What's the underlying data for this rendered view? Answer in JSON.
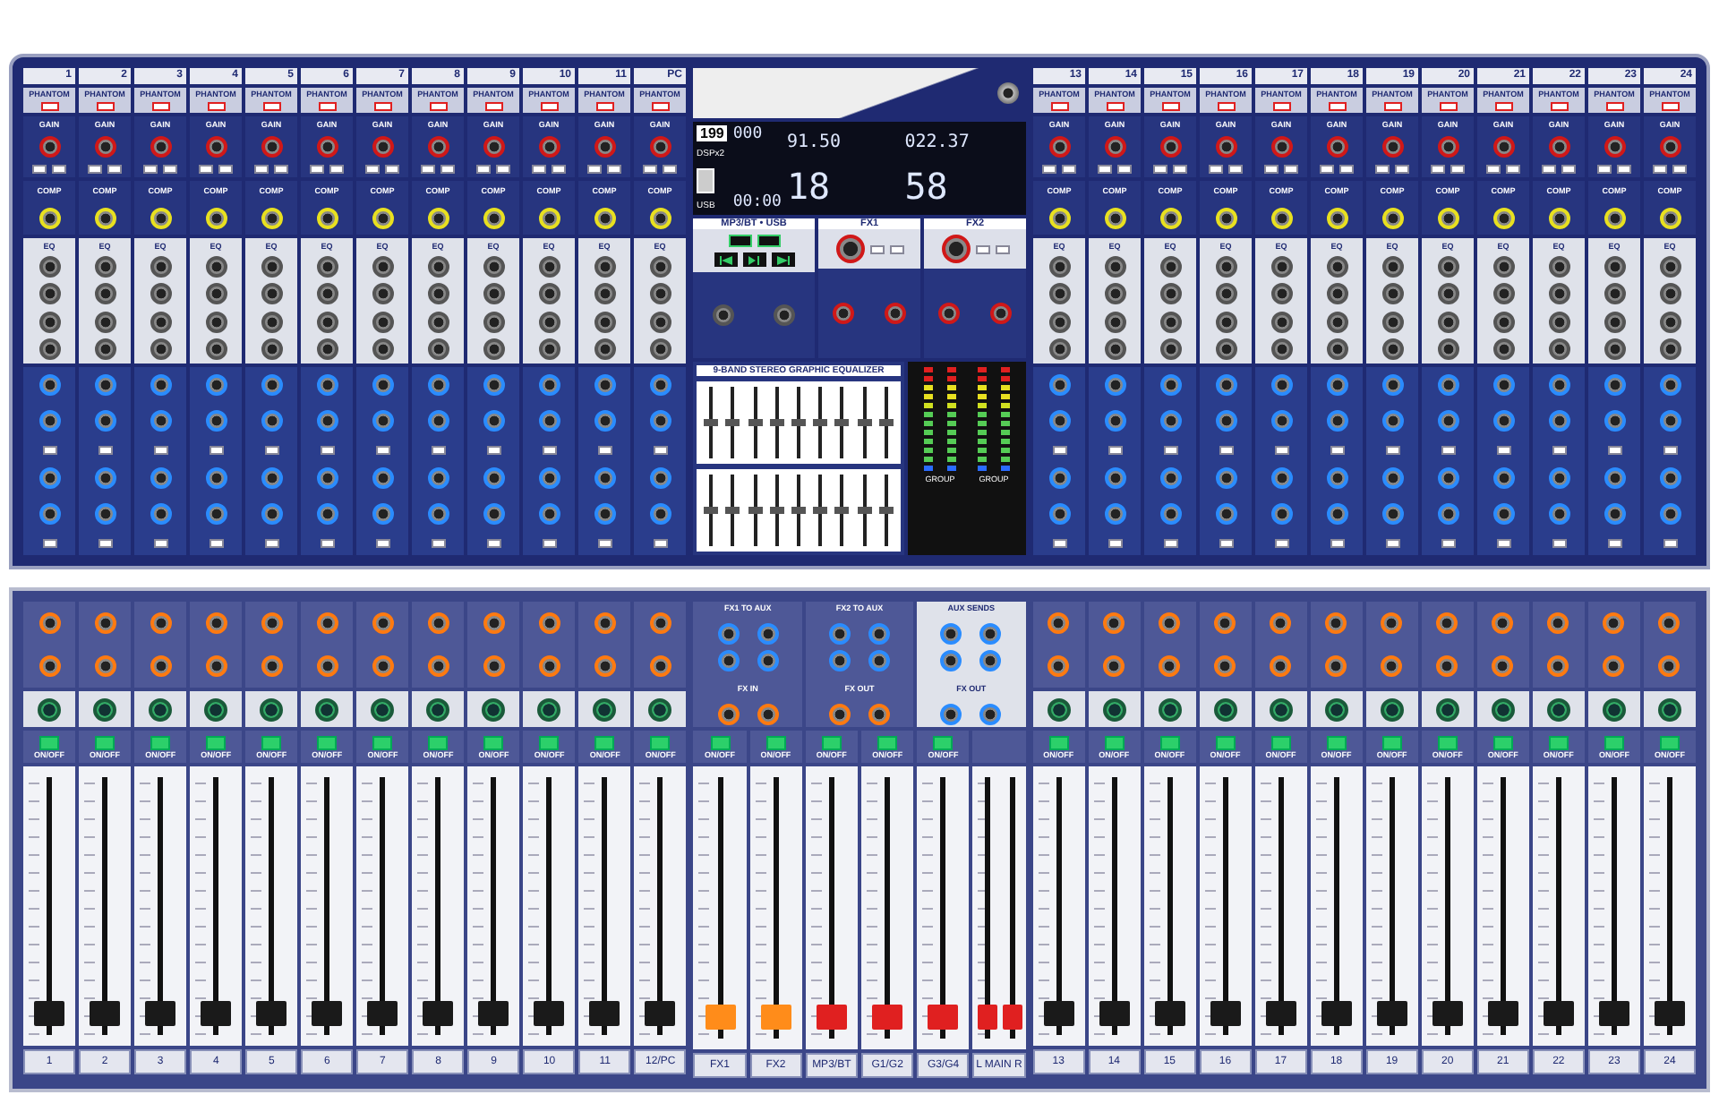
{
  "upper_left": [
    {
      "number": "1",
      "phantom": "PHANTOM",
      "gain": "GAIN",
      "comp": "COMP",
      "eq": "EQ"
    },
    {
      "number": "2",
      "phantom": "PHANTOM",
      "gain": "GAIN",
      "comp": "COMP",
      "eq": "EQ"
    },
    {
      "number": "3",
      "phantom": "PHANTOM",
      "gain": "GAIN",
      "comp": "COMP",
      "eq": "EQ"
    },
    {
      "number": "4",
      "phantom": "PHANTOM",
      "gain": "GAIN",
      "comp": "COMP",
      "eq": "EQ"
    },
    {
      "number": "5",
      "phantom": "PHANTOM",
      "gain": "GAIN",
      "comp": "COMP",
      "eq": "EQ"
    },
    {
      "number": "6",
      "phantom": "PHANTOM",
      "gain": "GAIN",
      "comp": "COMP",
      "eq": "EQ"
    },
    {
      "number": "7",
      "phantom": "PHANTOM",
      "gain": "GAIN",
      "comp": "COMP",
      "eq": "EQ"
    },
    {
      "number": "8",
      "phantom": "PHANTOM",
      "gain": "GAIN",
      "comp": "COMP",
      "eq": "EQ"
    },
    {
      "number": "9",
      "phantom": "PHANTOM",
      "gain": "GAIN",
      "comp": "COMP",
      "eq": "EQ"
    },
    {
      "number": "10",
      "phantom": "PHANTOM",
      "gain": "GAIN",
      "comp": "COMP",
      "eq": "EQ"
    },
    {
      "number": "11",
      "phantom": "PHANTOM",
      "gain": "GAIN",
      "comp": "COMP",
      "eq": "EQ"
    },
    {
      "number": "PC",
      "phantom": "PHANTOM",
      "gain": "GAIN",
      "comp": "COMP",
      "eq": "EQ"
    }
  ],
  "center_upper": {
    "counter": "199",
    "dsp": "DSPx2",
    "usb": "USB",
    "reading_1": "91.50",
    "reading_2": "022.37",
    "preset_1": "18",
    "preset_2": "58",
    "track": "000",
    "time": "00:00",
    "sections": [
      {
        "title": "MP3/BT • USB",
        "kind": "player"
      },
      {
        "title": "FX1",
        "kind": "fx"
      },
      {
        "title": "FX2",
        "kind": "fx"
      }
    ],
    "equalizer": {
      "title": "9-BAND STEREO GRAPHIC EQUALIZER",
      "rows": [
        {
          "sliders": [
            {
              "level": 0.5
            },
            {
              "level": 0.5
            },
            {
              "level": 0.5
            },
            {
              "level": 0.5
            },
            {
              "level": 0.5
            },
            {
              "level": 0.5
            },
            {
              "level": 0.5
            },
            {
              "level": 0.5
            },
            {
              "level": 0.5
            }
          ]
        },
        {
          "sliders": [
            {
              "level": 0.5
            },
            {
              "level": 0.5
            },
            {
              "level": 0.5
            },
            {
              "level": 0.5
            },
            {
              "level": 0.5
            },
            {
              "level": 0.5
            },
            {
              "level": 0.5
            },
            {
              "level": 0.5
            },
            {
              "level": 0.5
            }
          ]
        }
      ]
    },
    "meters": [
      {
        "label": "GROUP"
      },
      {
        "label": "GROUP"
      }
    ]
  },
  "upper_right": [
    {
      "number": "13",
      "phantom": "PHANTOM",
      "gain": "GAIN",
      "comp": "COMP",
      "eq": "EQ"
    },
    {
      "number": "14",
      "phantom": "PHANTOM",
      "gain": "GAIN",
      "comp": "COMP",
      "eq": "EQ"
    },
    {
      "number": "15",
      "phantom": "PHANTOM",
      "gain": "GAIN",
      "comp": "COMP",
      "eq": "EQ"
    },
    {
      "number": "16",
      "phantom": "PHANTOM",
      "gain": "GAIN",
      "comp": "COMP",
      "eq": "EQ"
    },
    {
      "number": "17",
      "phantom": "PHANTOM",
      "gain": "GAIN",
      "comp": "COMP",
      "eq": "EQ"
    },
    {
      "number": "18",
      "phantom": "PHANTOM",
      "gain": "GAIN",
      "comp": "COMP",
      "eq": "EQ"
    },
    {
      "number": "19",
      "phantom": "PHANTOM",
      "gain": "GAIN",
      "comp": "COMP",
      "eq": "EQ"
    },
    {
      "number": "20",
      "phantom": "PHANTOM",
      "gain": "GAIN",
      "comp": "COMP",
      "eq": "EQ"
    },
    {
      "number": "21",
      "phantom": "PHANTOM",
      "gain": "GAIN",
      "comp": "COMP",
      "eq": "EQ"
    },
    {
      "number": "22",
      "phantom": "PHANTOM",
      "gain": "GAIN",
      "comp": "COMP",
      "eq": "EQ"
    },
    {
      "number": "23",
      "phantom": "PHANTOM",
      "gain": "GAIN",
      "comp": "COMP",
      "eq": "EQ"
    },
    {
      "number": "24",
      "phantom": "PHANTOM",
      "gain": "GAIN",
      "comp": "COMP",
      "eq": "EQ"
    }
  ],
  "lower_left": [
    {
      "label": "1",
      "switch": "ON/OFF",
      "faders": [
        {
          "level": 0.08,
          "color": "#1a1a1a"
        }
      ]
    },
    {
      "label": "2",
      "switch": "ON/OFF",
      "faders": [
        {
          "level": 0.08,
          "color": "#1a1a1a"
        }
      ]
    },
    {
      "label": "3",
      "switch": "ON/OFF",
      "faders": [
        {
          "level": 0.08,
          "color": "#1a1a1a"
        }
      ]
    },
    {
      "label": "4",
      "switch": "ON/OFF",
      "faders": [
        {
          "level": 0.08,
          "color": "#1a1a1a"
        }
      ]
    },
    {
      "label": "5",
      "switch": "ON/OFF",
      "faders": [
        {
          "level": 0.08,
          "color": "#1a1a1a"
        }
      ]
    },
    {
      "label": "6",
      "switch": "ON/OFF",
      "faders": [
        {
          "level": 0.08,
          "color": "#1a1a1a"
        }
      ]
    },
    {
      "label": "7",
      "switch": "ON/OFF",
      "faders": [
        {
          "level": 0.08,
          "color": "#1a1a1a"
        }
      ]
    },
    {
      "label": "8",
      "switch": "ON/OFF",
      "faders": [
        {
          "level": 0.08,
          "color": "#1a1a1a"
        }
      ]
    },
    {
      "label": "9",
      "switch": "ON/OFF",
      "faders": [
        {
          "level": 0.08,
          "color": "#1a1a1a"
        }
      ]
    },
    {
      "label": "10",
      "switch": "ON/OFF",
      "faders": [
        {
          "level": 0.08,
          "color": "#1a1a1a"
        }
      ]
    },
    {
      "label": "11",
      "switch": "ON/OFF",
      "faders": [
        {
          "level": 0.08,
          "color": "#1a1a1a"
        }
      ]
    },
    {
      "label": "12/PC",
      "switch": "ON/OFF",
      "faders": [
        {
          "level": 0.08,
          "color": "#1a1a1a"
        }
      ]
    }
  ],
  "lower_center": {
    "groups": [
      {
        "title": "FX1 TO AUX",
        "subtitle": "FX IN",
        "kind": "fx"
      },
      {
        "title": "FX2 TO AUX",
        "subtitle": "FX OUT",
        "kind": "fx"
      },
      {
        "title": "AUX SENDS",
        "subtitle": "FX OUT",
        "kind": "aux"
      }
    ],
    "strips": [
      {
        "label": "FX1",
        "switch": "ON/OFF",
        "faders": [
          {
            "level": 0.08,
            "color": "#ff8c1a"
          }
        ]
      },
      {
        "label": "FX2",
        "switch": "ON/OFF",
        "faders": [
          {
            "level": 0.08,
            "color": "#ff8c1a"
          }
        ]
      },
      {
        "label": "MP3/BT",
        "switch": "ON/OFF",
        "faders": [
          {
            "level": 0.08,
            "color": "#e02020"
          }
        ]
      },
      {
        "label": "G1/G2",
        "switch": "ON/OFF",
        "faders": [
          {
            "level": 0.08,
            "color": "#e02020"
          }
        ]
      },
      {
        "label": "G3/G4",
        "switch": "ON/OFF",
        "faders": [
          {
            "level": 0.08,
            "color": "#e02020"
          }
        ]
      },
      {
        "label": "L MAIN R",
        "faders": [
          {
            "level": 0.08,
            "color": "#e02020"
          },
          {
            "level": 0.08,
            "color": "#e02020"
          }
        ]
      }
    ]
  },
  "lower_right": [
    {
      "label": "13",
      "switch": "ON/OFF",
      "faders": [
        {
          "level": 0.08,
          "color": "#1a1a1a"
        }
      ]
    },
    {
      "label": "14",
      "switch": "ON/OFF",
      "faders": [
        {
          "level": 0.08,
          "color": "#1a1a1a"
        }
      ]
    },
    {
      "label": "15",
      "switch": "ON/OFF",
      "faders": [
        {
          "level": 0.08,
          "color": "#1a1a1a"
        }
      ]
    },
    {
      "label": "16",
      "switch": "ON/OFF",
      "faders": [
        {
          "level": 0.08,
          "color": "#1a1a1a"
        }
      ]
    },
    {
      "label": "17",
      "switch": "ON/OFF",
      "faders": [
        {
          "level": 0.08,
          "color": "#1a1a1a"
        }
      ]
    },
    {
      "label": "18",
      "switch": "ON/OFF",
      "faders": [
        {
          "level": 0.08,
          "color": "#1a1a1a"
        }
      ]
    },
    {
      "label": "19",
      "switch": "ON/OFF",
      "faders": [
        {
          "level": 0.08,
          "color": "#1a1a1a"
        }
      ]
    },
    {
      "label": "20",
      "switch": "ON/OFF",
      "faders": [
        {
          "level": 0.08,
          "color": "#1a1a1a"
        }
      ]
    },
    {
      "label": "21",
      "switch": "ON/OFF",
      "faders": [
        {
          "level": 0.08,
          "color": "#1a1a1a"
        }
      ]
    },
    {
      "label": "22",
      "switch": "ON/OFF",
      "faders": [
        {
          "level": 0.08,
          "color": "#1a1a1a"
        }
      ]
    },
    {
      "label": "23",
      "switch": "ON/OFF",
      "faders": [
        {
          "level": 0.08,
          "color": "#1a1a1a"
        }
      ]
    },
    {
      "label": "24",
      "switch": "ON/OFF",
      "faders": [
        {
          "level": 0.08,
          "color": "#1a1a1a"
        }
      ]
    }
  ]
}
